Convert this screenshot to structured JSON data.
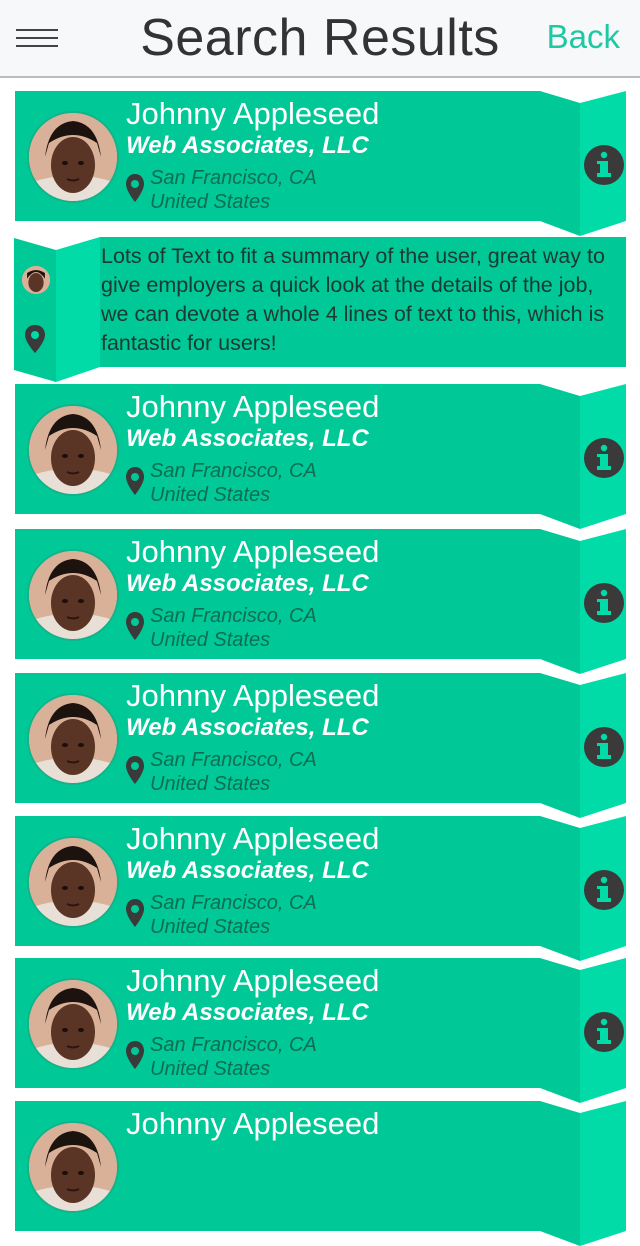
{
  "header": {
    "title": "Search Results",
    "back_label": "Back"
  },
  "colors": {
    "accent": "#1dc9a2",
    "card": "#00c896",
    "ribbon": "#00dba7",
    "icon": "#3a3a3a"
  },
  "icons": {
    "menu": "hamburger-icon",
    "location": "map-pin-icon",
    "info": "info-icon"
  },
  "results": [
    {
      "name": "Johnny Appleseed",
      "company": "Web Associates, LLC",
      "city": "San Francisco, CA",
      "country": "United States"
    },
    {
      "name": "Johnny Appleseed",
      "company": "Web Associates, LLC",
      "city": "San Francisco, CA",
      "country": "United States"
    },
    {
      "name": "Johnny Appleseed",
      "company": "Web Associates, LLC",
      "city": "San Francisco, CA",
      "country": "United States"
    },
    {
      "name": "Johnny Appleseed",
      "company": "Web Associates, LLC",
      "city": "San Francisco, CA",
      "country": "United States"
    },
    {
      "name": "Johnny Appleseed",
      "company": "Web Associates, LLC",
      "city": "San Francisco, CA",
      "country": "United States"
    },
    {
      "name": "Johnny Appleseed",
      "company": "Web Associates, LLC",
      "city": "San Francisco, CA",
      "country": "United States"
    },
    {
      "name": "Johnny Appleseed"
    }
  ],
  "summary": {
    "text": "Lots of Text to fit a summary of the user, great way to give employers a quick look at the details of the job, we can devote a whole 4 lines of text to this, which is fantastic for users!"
  }
}
